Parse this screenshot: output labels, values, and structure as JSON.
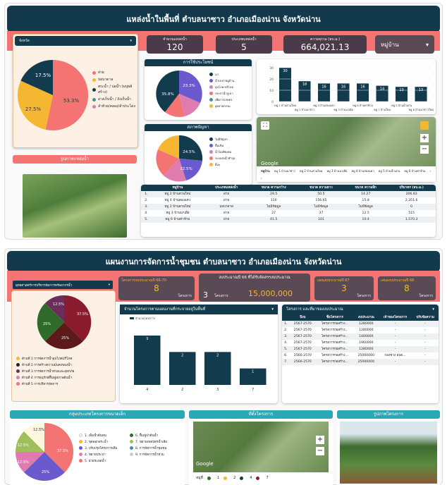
{
  "s1": {
    "title": "แหล่งน้ำในพื้นที่ ตำบลนาซาว อำเภอเมืองน่าน จังหวัดน่าน",
    "province_label": "จังหวัด",
    "pie_legend": [
      "ฝาย",
      "บ่อบาดาล",
      "สระน้ำ / บ่อน้ำ (มนุษย์สร้าง)",
      "อ่างเก็บน้ำ / ถังเก็บน้ำ",
      "ลำห้วย/คลอง/ลำประโดง"
    ],
    "pie_colors": [
      "#f47373",
      "#f5b731",
      "#133b4e",
      "#4a8c9a",
      "#e07bb0"
    ],
    "pie_labels": [
      "53.3%",
      "27.5%",
      "17.5%"
    ],
    "kpis": [
      {
        "label": "จำนวนแหล่งน้ำ",
        "value": "120"
      },
      {
        "label": "ประเภทแหล่งน้ำ",
        "value": "5"
      },
      {
        "label": "ความจุรวม (ลบ.ม.)",
        "value": "664,021.13"
      }
    ],
    "village_select": "หมู่บ้าน",
    "photo_title": "รูปภาพแหล่งน้ำ",
    "use_title": "การใช้ประโยชน์",
    "use_labels": [
      "35.8%",
      "23.3%"
    ],
    "use_legend": [
      "นา",
      "น้ำปะปาหมู่บ้าน",
      "อุปโภค-บริโภค",
      "ประปาน้ำภูเขา",
      "เพื่อการเกษตร",
      "อุตสาหกรรม"
    ],
    "problem_title": "สภาพปัญหา",
    "problem_labels": [
      "24.5%",
      "22.5%"
    ],
    "problem_legend": [
      "ไม่มีปัญหา",
      "ตื้นเขิน",
      "น้ำไม่เพียงพอ",
      "ระบบส่งน้ำชำรุด",
      "อื่นๆ"
    ],
    "bars_ylabels": [
      "30",
      "20",
      "10",
      "0"
    ],
    "map_google": "Google",
    "map_legend": [
      "หมู่ 1 บ้านนาซาว",
      "หมู่ 2 บ้านสวนใหม่",
      "หมู่ 3 บ้านนาเผือ",
      "หมู่ 4 บ้านสองแคว",
      "หมู่ 5 บ้านน้ำแก่น",
      "หมู่ 6 บ้านท่าข้าม"
    ],
    "map_village_label": "หมู่บ้าน",
    "table_headers": [
      "",
      "หมู่บ้าน",
      "ประเภทแหล่งน้ำ",
      "ขนาด ความกว้าง",
      "ขนาด ความยาว",
      "ขนาด ความลึก",
      "ปริมาตร (ลบ.ม.)"
    ],
    "table_rows": [
      [
        "1.",
        "หมู่ 2 บ้านสวนใหม่",
        "ฝาย",
        "29.5",
        "50.5",
        "14.27",
        "206.83"
      ],
      [
        "2.",
        "หมู่ 4 บ้านสองแคว",
        "ฝาย",
        "110",
        "156.65",
        "15.8",
        "2,351.6"
      ],
      [
        "3.",
        "หมู่ 2 บ้านสวนใหม่",
        "บ่อบาดาล",
        "ไม่มีข้อมูล",
        "ไม่มีข้อมูล",
        "ไม่มีข้อมูล",
        "0"
      ],
      [
        "4.",
        "หมู่ 3 บ้านนาเผือ",
        "ฝาย",
        "27",
        "37",
        "12.5",
        "515"
      ],
      [
        "5.",
        "หมู่ 6 บ้านท่าข้าม",
        "ฝาย",
        "41.5",
        "101",
        "10.4",
        "1,570.3"
      ]
    ]
  },
  "chart_data": {
    "type": "bar",
    "categories": [
      "หมู่ 2 บ้านสวนใหม่",
      "หมู่ 1 บ้านนาซาว",
      "หมู่ 4 บ้านสองแคว",
      "หมู่ 3 บ้านนาเผือ",
      "หมู่ 6 บ้านท่าข้าม",
      "หมู่ 7 บ้านใหม่",
      "หมู่ 5 บ้านน้ำแก่น",
      "หมู่ 8 บ้านนาซาวใหม่"
    ],
    "values": [
      30,
      18,
      16,
      16,
      16,
      14,
      13,
      13
    ],
    "ylim": [
      0,
      30
    ]
  },
  "s2": {
    "title": "แผนงานการจัดการน้ำชุมชน ตำบลนาซาว อำเภอเมืองน่าน จังหวัดน่าน",
    "strategy_label": "ยุทธศาสตร์การบริหารจัดการทรัพยากรน้ำ",
    "kpi_a": {
      "label": "โครงการงบประมาณปี 66-70",
      "value": "8",
      "unit": "โครงการ"
    },
    "kpi_b": {
      "label": "งบประมาณปี 66 ที่ได้รับจัดสรรงบประมาณ",
      "count": "3",
      "unit": "โครงการ",
      "amount": "15,000,000"
    },
    "kpi_c": {
      "label": "แผนงบประมาณปี 67",
      "value": "3",
      "unit": "โครงการ"
    },
    "kpi_d": {
      "label": "เสนองบประมาณปี 68",
      "value": "8",
      "unit": "โครงการ"
    },
    "pie_labels": [
      "37.5%",
      "25%",
      "25%",
      "12.5%"
    ],
    "pie_legend": [
      "ด้านที่ 1 การจัดการน้ำอุปโภคบริโภค",
      "ด้านที่ 2 การสร้างความมั่นคงของน้ำ",
      "ด้านที่ 3 การจัดการน้ำท่วมและอุทกภัย",
      "ด้านที่ 4 การอนุรักษ์ฟื้นฟูสภาพต้นน้ำ",
      "ด้านที่ 5 การบริหารจัดการ"
    ],
    "bar_title": "จำนวนโครงการตามแผนงานที่กระจายอยู่ในพื้นที่",
    "bar_legend": "จำนวนโครงการ",
    "bar_values": [
      "3",
      "2",
      "2",
      "1"
    ],
    "bar_cats": [
      "4",
      "2",
      "3",
      "7"
    ],
    "proj_title": "โครงการ และที่มาของงบประมาณ",
    "proj_headers": [
      "",
      "ปีงบ",
      "ชื่อโครงการ",
      "งบประมาณ",
      "เจ้าของโครงการ",
      "ปรับข้อความ"
    ],
    "proj_rows": [
      [
        "1.",
        "2567-2570",
        "โครงการก่อสร้าง...",
        "1280000",
        "-",
        "-"
      ],
      [
        "2.",
        "2567-2570",
        "โครงการก่อสร้าง...",
        "1280000",
        "-",
        "-"
      ],
      [
        "3.",
        "2567-2570",
        "โครงการก่อสร้าง...",
        "1400000",
        "-",
        "-"
      ],
      [
        "4.",
        "2567-2570",
        "โครงการก่อสร้าง...",
        "1960000",
        "-",
        "-"
      ],
      [
        "5.",
        "2567-2570",
        "โครงการก่อสร้าง...",
        "1280000",
        "-",
        "-"
      ],
      [
        "6.",
        "2566-2570",
        "โครงการก่อสร้าง...",
        "25000000",
        "กองช่าง อบต...",
        "-"
      ],
      [
        "7.",
        "2566-2570",
        "โครงการก่อสร้าง...",
        "25000000",
        "-",
        "-"
      ]
    ],
    "small_title": "กลุ่มประเภทโครงการขนาดเล็ก",
    "small_labels": [
      "37.5%",
      "25%",
      "12.5%",
      "12.5%",
      "12.5%"
    ],
    "small_legend": [
      "1. เพิ่มน้ำต้นทุน",
      "2. ขุดลอกสระน้ำ",
      "3. ปรับปรุงโครงการเดิม",
      "4. ขยายประปา",
      "5. ฝายชะลอน้ำ",
      "6. ฟื้นฟูป่าต้นน้ำ",
      "7. ขยายเขตบัตรน้ำเสีย",
      "8. การจัดการน้ำชุมชน",
      "9. การจัดการน้ำท่วม"
    ],
    "loc_title": "ที่ตั้งโครงการ",
    "map_google": "Google",
    "map_legend_label": "หมู่ที่",
    "map_legend": [
      "1",
      "2",
      "4",
      "7"
    ],
    "photo_title": "รูปภาพโครงการ"
  }
}
